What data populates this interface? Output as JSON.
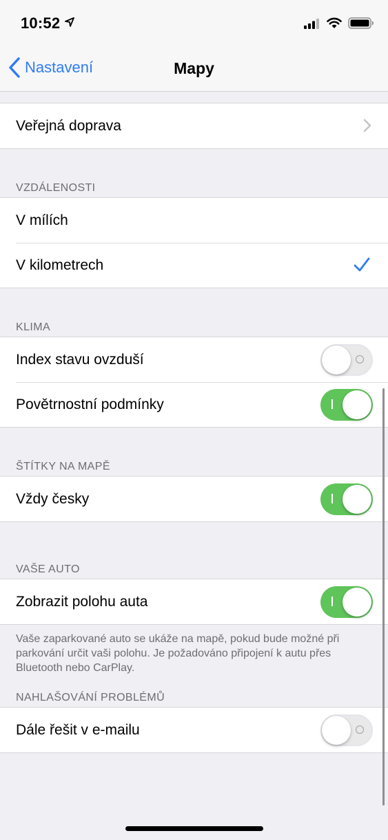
{
  "status": {
    "time": "10:52",
    "icons": [
      "location-arrow-icon",
      "cellular-signal-icon",
      "wifi-icon",
      "battery-icon"
    ]
  },
  "nav": {
    "back_label": "Nastavení",
    "title": "Mapy"
  },
  "groups": {
    "top": {
      "rows": [
        {
          "label": "Veřejná doprava",
          "accessory": "chevron"
        }
      ]
    },
    "distances": {
      "header": "VZDÁLENOSTI",
      "rows": [
        {
          "label": "V mílích",
          "selected": false
        },
        {
          "label": "V kilometrech",
          "selected": true
        }
      ]
    },
    "climate": {
      "header": "KLIMA",
      "rows": [
        {
          "label": "Index stavu ovzduší",
          "toggle": false
        },
        {
          "label": "Povětrnostní podmínky",
          "toggle": true
        }
      ]
    },
    "labels": {
      "header": "ŠTÍTKY NA MAPĚ",
      "rows": [
        {
          "label": "Vždy česky",
          "toggle": true
        }
      ]
    },
    "car": {
      "header": "VAŠE AUTO",
      "rows": [
        {
          "label": "Zobrazit polohu auta",
          "toggle": true
        }
      ],
      "footer": "Vaše zaparkované auto se ukáže na mapě, pokud bude možné při parkování určit vaši polohu. Je požadováno připojení k autu přes Bluetooth nebo CarPlay."
    },
    "reporting": {
      "header": "NAHLAŠOVÁNÍ PROBLÉMŮ",
      "rows": [
        {
          "label": "Dále řešit v e-mailu",
          "toggle": false
        }
      ]
    }
  },
  "colors": {
    "accent": "#2f7cf6",
    "toggle_on": "#5fc45a",
    "toggle_off": "#e9e9ea",
    "background": "#efeff4"
  }
}
